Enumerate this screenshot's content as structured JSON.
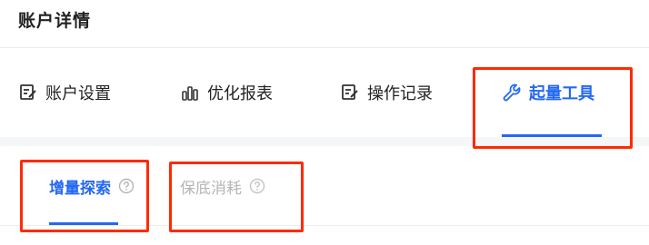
{
  "page": {
    "title": "账户详情"
  },
  "main_tabs": [
    {
      "label": "账户设置",
      "icon": "edit-icon"
    },
    {
      "label": "优化报表",
      "icon": "bar-chart-icon"
    },
    {
      "label": "操作记录",
      "icon": "edit-icon"
    },
    {
      "label": "起量工具",
      "icon": "wrench-icon",
      "active": true
    }
  ],
  "sub_tabs": [
    {
      "label": "增量探索",
      "icon": "help-icon",
      "active": true
    },
    {
      "label": "保底消耗",
      "icon": "help-icon",
      "disabled": true
    }
  ],
  "colors": {
    "accent": "#2468f2",
    "highlight": "#ff2a00",
    "disabled": "#b5b5b5"
  }
}
